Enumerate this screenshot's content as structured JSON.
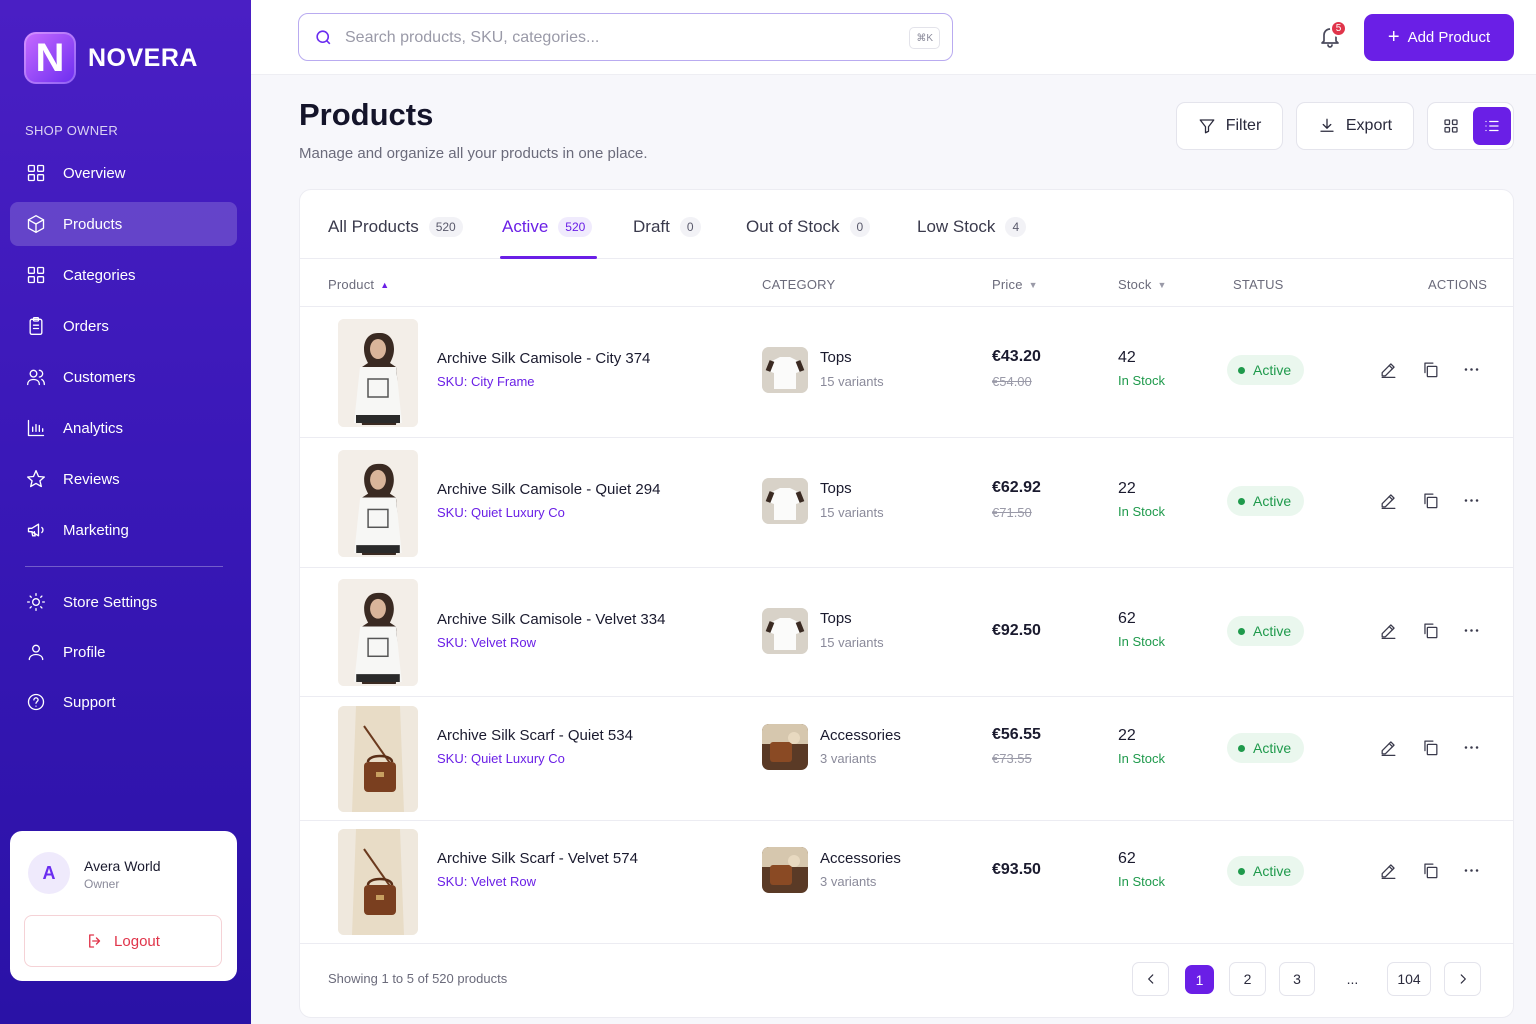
{
  "brand": {
    "logo_letter": "N",
    "name": "NOVERA"
  },
  "sidebar": {
    "section_label": "SHOP OWNER",
    "items": [
      {
        "label": "Overview",
        "icon": "grid-icon",
        "active": false
      },
      {
        "label": "Products",
        "icon": "box-icon",
        "active": true
      },
      {
        "label": "Categories",
        "icon": "grid-icon",
        "active": false
      },
      {
        "label": "Orders",
        "icon": "clipboard-icon",
        "active": false
      },
      {
        "label": "Customers",
        "icon": "users-icon",
        "active": false
      },
      {
        "label": "Analytics",
        "icon": "bar-chart-icon",
        "active": false
      },
      {
        "label": "Reviews",
        "icon": "star-icon",
        "active": false
      },
      {
        "label": "Marketing",
        "icon": "megaphone-icon",
        "active": false
      }
    ],
    "bottom_items": [
      {
        "label": "Store Settings",
        "icon": "gear-icon"
      },
      {
        "label": "Profile",
        "icon": "user-icon"
      },
      {
        "label": "Support",
        "icon": "help-icon"
      }
    ],
    "user": {
      "initial": "A",
      "name": "Avera World",
      "role": "Owner",
      "logout_label": "Logout"
    }
  },
  "topbar": {
    "search_placeholder": "Search products, SKU, categories...",
    "shortcut": "⌘K",
    "notification_count": "5",
    "add_button_label": "Add Product"
  },
  "page": {
    "title": "Products",
    "subtitle": "Manage and organize all your products in one place.",
    "filter_label": "Filter",
    "export_label": "Export",
    "view_mode": "list"
  },
  "tabs": [
    {
      "label": "All Products",
      "count": "520"
    },
    {
      "label": "Active",
      "count": "520",
      "active": true
    },
    {
      "label": "Draft",
      "count": "0"
    },
    {
      "label": "Out of Stock",
      "count": "0"
    },
    {
      "label": "Low Stock",
      "count": "4"
    }
  ],
  "columns": {
    "product": "Product",
    "category": "CATEGORY",
    "price": "Price",
    "stock": "Stock",
    "status": "STATUS",
    "actions": "ACTIONS"
  },
  "rows": [
    {
      "name": "Archive Silk Camisole - City 374",
      "sku": "SKU: City Frame",
      "category": "Tops",
      "variants": "15 variants",
      "price": "€43.20",
      "old_price": "€54.00",
      "stock": "42",
      "stock_label": "In Stock",
      "status": "Active",
      "image": "tshirt-model"
    },
    {
      "name": "Archive Silk Camisole - Quiet 294",
      "sku": "SKU: Quiet Luxury Co",
      "category": "Tops",
      "variants": "15 variants",
      "price": "€62.92",
      "old_price": "€71.50",
      "stock": "22",
      "stock_label": "In Stock",
      "status": "Active",
      "image": "tshirt-model"
    },
    {
      "name": "Archive Silk Camisole - Velvet 334",
      "sku": "SKU: Velvet Row",
      "category": "Tops",
      "variants": "15 variants",
      "price": "€92.50",
      "old_price": "",
      "stock": "62",
      "stock_label": "In Stock",
      "status": "Active",
      "image": "tshirt-model"
    },
    {
      "name": "Archive Silk Scarf - Quiet 534",
      "sku": "SKU: Quiet Luxury Co",
      "category": "Accessories",
      "variants": "3 variants",
      "price": "€56.55",
      "old_price": "€73.55",
      "stock": "22",
      "stock_label": "In Stock",
      "status": "Active",
      "image": "bag-model"
    },
    {
      "name": "Archive Silk Scarf - Velvet 574",
      "sku": "SKU: Velvet Row",
      "category": "Accessories",
      "variants": "3 variants",
      "price": "€93.50",
      "old_price": "",
      "stock": "62",
      "stock_label": "In Stock",
      "status": "Active",
      "image": "bag-model"
    }
  ],
  "pagination": {
    "summary": "Showing 1 to 5 of 520 products",
    "pages": [
      "1",
      "2",
      "3",
      "...",
      "104"
    ],
    "current": "1"
  },
  "colors": {
    "accent": "#6a1fe6",
    "sidebar": "#3a18b8",
    "success": "#1f9a4c",
    "danger": "#e0344a"
  }
}
